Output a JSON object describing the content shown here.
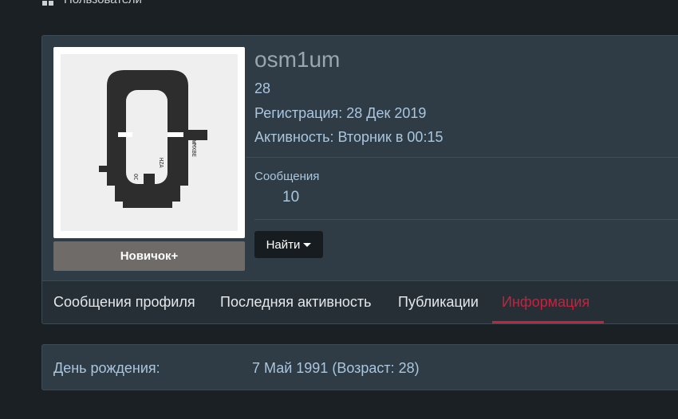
{
  "breadcrumb": {
    "label": "Пользователи"
  },
  "profile": {
    "username": "osm1um",
    "age": "28",
    "registration": "Регистрация: 28 Дек 2019",
    "activity": "Активность: Вторник в 00:15",
    "rank": "Новичок+",
    "stats": {
      "label": "Сообщения",
      "value": "10"
    },
    "find_button": "Найти",
    "avatar_letters": {
      "left": "OC",
      "middle": "HZA",
      "right": "WMXBE"
    }
  },
  "tabs": [
    {
      "label": "Сообщения профиля",
      "active": false
    },
    {
      "label": "Последняя активность",
      "active": false
    },
    {
      "label": "Публикации",
      "active": false
    },
    {
      "label": "Информация",
      "active": true
    }
  ],
  "about": {
    "birthday_label": "День рождения:",
    "birthday_value": "7 Май 1991 (Возраст: 28)"
  },
  "colors": {
    "page_bg": "#1b2024",
    "card_bg": "#303c45",
    "accent": "#c8213d",
    "link_text": "#a9c6de"
  }
}
